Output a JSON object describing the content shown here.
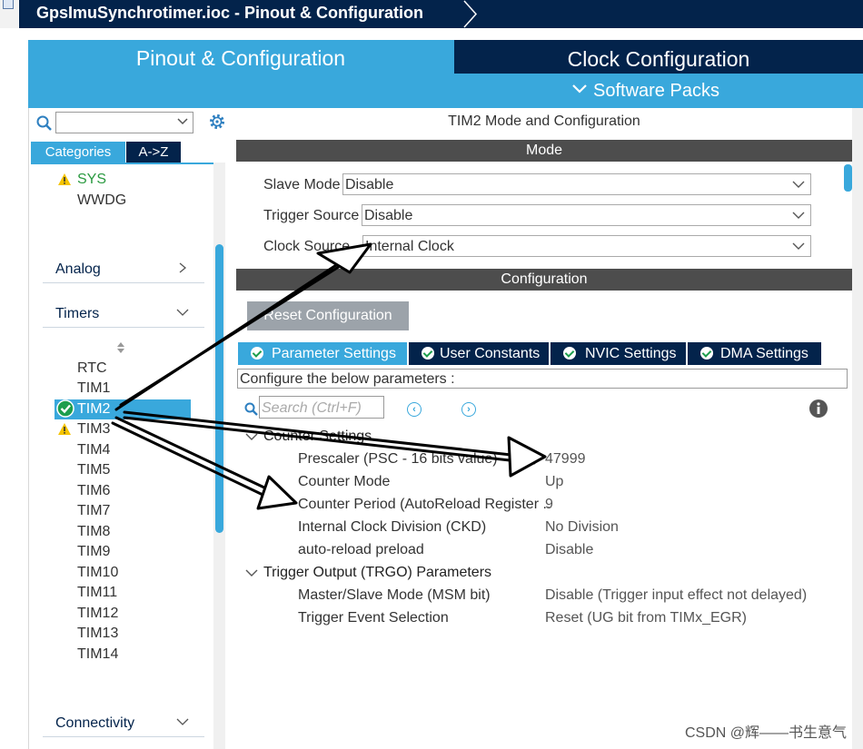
{
  "title_bar": {
    "title": "GpsImuSynchrotimer.ioc - Pinout & Configuration"
  },
  "main_tabs": {
    "pinout": "Pinout & Configuration",
    "clock": "Clock Configuration",
    "software_packs": "Software Packs"
  },
  "left_panel": {
    "search_value": "",
    "tabs": {
      "categories": "Categories",
      "az": "A->Z"
    },
    "system_items": [
      {
        "label": "SYS",
        "status": "warning"
      },
      {
        "label": "WWDG"
      }
    ],
    "sections": {
      "analog": "Analog",
      "timers": "Timers",
      "connectivity": "Connectivity"
    },
    "timer_items": [
      {
        "label": "RTC"
      },
      {
        "label": "TIM1"
      },
      {
        "label": "TIM2",
        "status": "enabled",
        "selected": true
      },
      {
        "label": "TIM3",
        "status": "warning"
      },
      {
        "label": "TIM4"
      },
      {
        "label": "TIM5"
      },
      {
        "label": "TIM6"
      },
      {
        "label": "TIM7"
      },
      {
        "label": "TIM8"
      },
      {
        "label": "TIM9"
      },
      {
        "label": "TIM10"
      },
      {
        "label": "TIM11"
      },
      {
        "label": "TIM12"
      },
      {
        "label": "TIM13"
      },
      {
        "label": "TIM14"
      }
    ]
  },
  "right_panel": {
    "title": "TIM2 Mode and Configuration",
    "mode_header": "Mode",
    "mode_fields": [
      {
        "label": "Slave Mode",
        "value": "Disable"
      },
      {
        "label": "Trigger Source",
        "value": "Disable"
      },
      {
        "label": "Clock Source",
        "value": "Internal Clock"
      }
    ],
    "config_header": "Configuration",
    "reset_button": "Reset Configuration",
    "param_tabs": [
      "Parameter Settings",
      "User Constants",
      "NVIC Settings",
      "DMA Settings"
    ],
    "config_hint": "Configure the below parameters :",
    "search_placeholder": "Search (Ctrl+F)",
    "groups": [
      {
        "name": "Counter Settings",
        "params": [
          {
            "name": "Prescaler (PSC - 16 bits value)",
            "value": "47999"
          },
          {
            "name": "Counter Mode",
            "value": "Up"
          },
          {
            "name": "Counter Period (AutoReload Register ..",
            "value": "9"
          },
          {
            "name": "Internal Clock Division (CKD)",
            "value": "No Division"
          },
          {
            "name": "auto-reload preload",
            "value": "Disable"
          }
        ]
      },
      {
        "name": "Trigger Output (TRGO) Parameters",
        "params": [
          {
            "name": "Master/Slave Mode (MSM bit)",
            "value": "Disable (Trigger input effect not delayed)"
          },
          {
            "name": "Trigger Event Selection",
            "value": "Reset (UG bit from TIMx_EGR)"
          }
        ]
      }
    ]
  },
  "watermark": "CSDN @辉——书生意气",
  "colors": {
    "navy": "#03234b",
    "accent": "#39a8dc",
    "header_gray": "#4d4d4d",
    "warning": "#f5c400",
    "ok_green": "#1d9e4d"
  }
}
